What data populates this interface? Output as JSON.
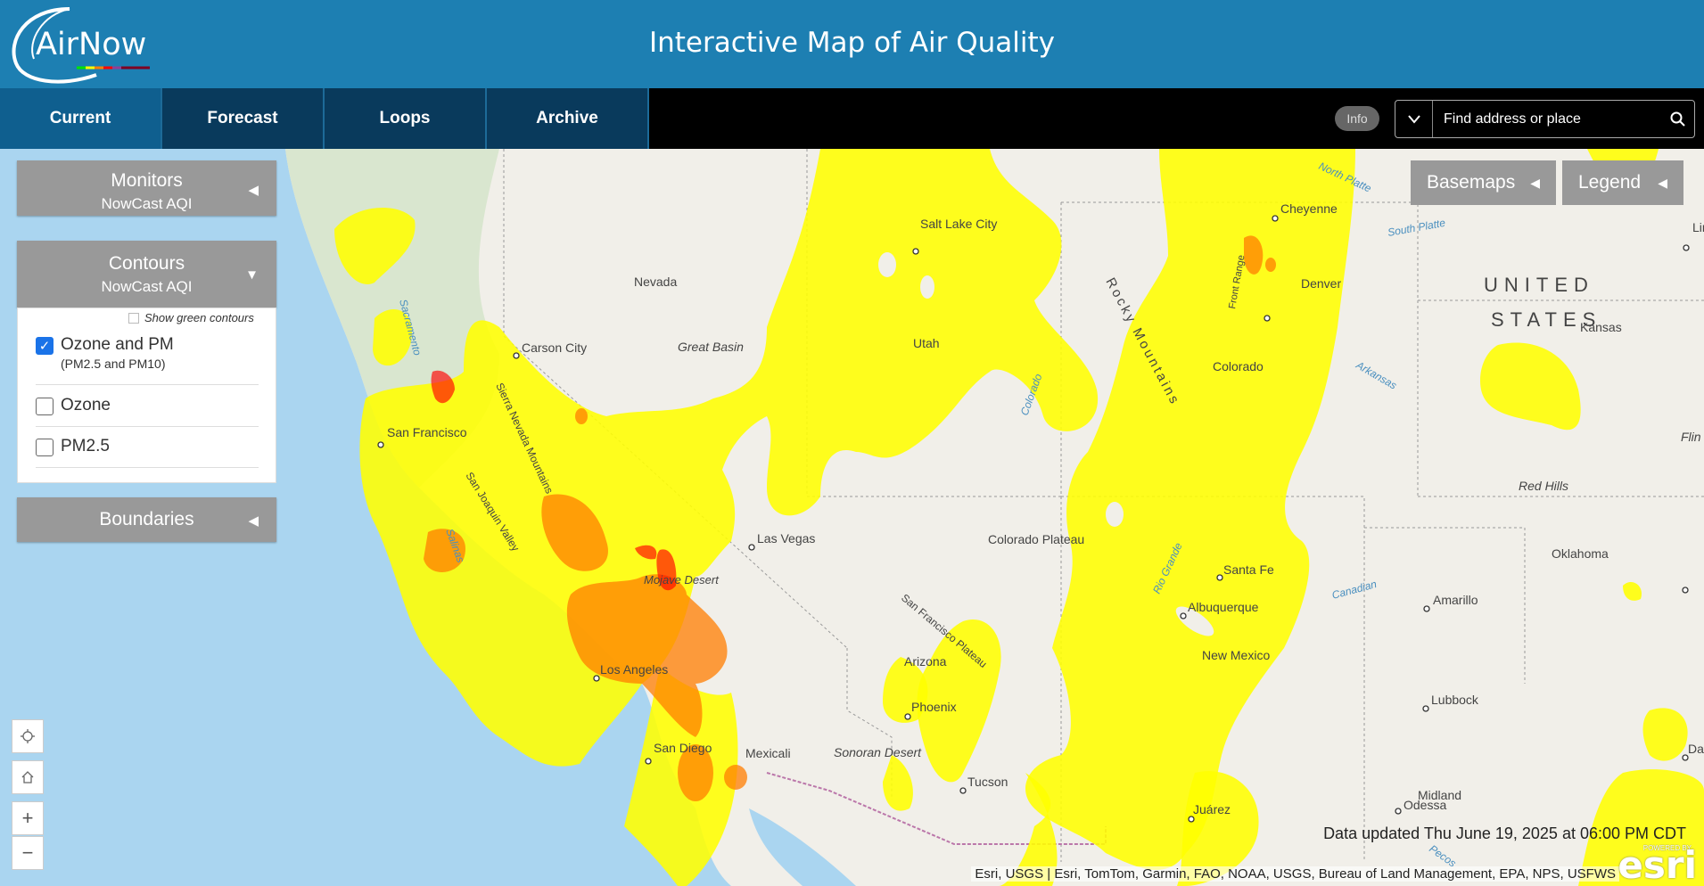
{
  "header": {
    "logo_text": "AirNow",
    "title": "Interactive Map of Air Quality"
  },
  "nav": {
    "tabs": [
      {
        "label": "Current"
      },
      {
        "label": "Forecast"
      },
      {
        "label": "Loops"
      },
      {
        "label": "Archive"
      }
    ],
    "info_label": "Info",
    "search_placeholder": "Find address or place"
  },
  "panels": {
    "monitors": {
      "title": "Monitors",
      "subtitle": "NowCast AQI"
    },
    "contours": {
      "title": "Contours",
      "subtitle": "NowCast AQI",
      "show_green_label": "Show green contours",
      "options": [
        {
          "label": "Ozone and PM",
          "sublabel": "(PM2.5 and PM10)",
          "checked": true
        },
        {
          "label": "Ozone",
          "sublabel": "",
          "checked": false
        },
        {
          "label": "PM2.5",
          "sublabel": "",
          "checked": false
        }
      ]
    },
    "boundaries": {
      "title": "Boundaries"
    }
  },
  "map_controls": {
    "basemaps_label": "Basemaps",
    "legend_label": "Legend",
    "zoom_in": "+",
    "zoom_out": "−"
  },
  "map_labels": {
    "cities": [
      "Salt Lake City",
      "Cheyenne",
      "Denver",
      "Carson City",
      "San Francisco",
      "Las Vegas",
      "Los Angeles",
      "San Diego",
      "Mexicali",
      "Phoenix",
      "Tucson",
      "Santa Fe",
      "Albuquerque",
      "Amarillo",
      "Lubbock",
      "Midland",
      "Odessa",
      "Juárez",
      "Oklahoma",
      "Kansas",
      "Da",
      "Lin",
      "Flin"
    ],
    "regions": [
      "Nevada",
      "Great Basin",
      "Utah",
      "Colorado",
      "Colorado Plateau",
      "Arizona",
      "New Mexico",
      "Sonoran Desert",
      "Mojave Desert",
      "Red Hills",
      "UNITED",
      "STATES",
      "Rocky Mountains",
      "Sierra Nevada Mountains",
      "San Joaquin Valley",
      "San Francisco Plateau",
      "Front Range"
    ],
    "rivers": [
      "Sacramento",
      "North Platte",
      "South Platte",
      "Arkansas",
      "Colorado",
      "Rio Grande",
      "Canadian",
      "Pecos",
      "Salinas"
    ]
  },
  "aqi_colors": {
    "moderate": "#ffff00",
    "usg": "#ff7e00",
    "unhealthy": "#ff0000"
  },
  "footer": {
    "updated": "Data updated Thu June 19, 2025 at 06:00 PM CDT",
    "attribution": "Esri, USGS | Esri, TomTom, Garmin, FAO, NOAA, USGS, Bureau of Land Management, EPA, NPS, USFWS",
    "esri_brand": "esri",
    "esri_powered": "POWERED BY"
  }
}
